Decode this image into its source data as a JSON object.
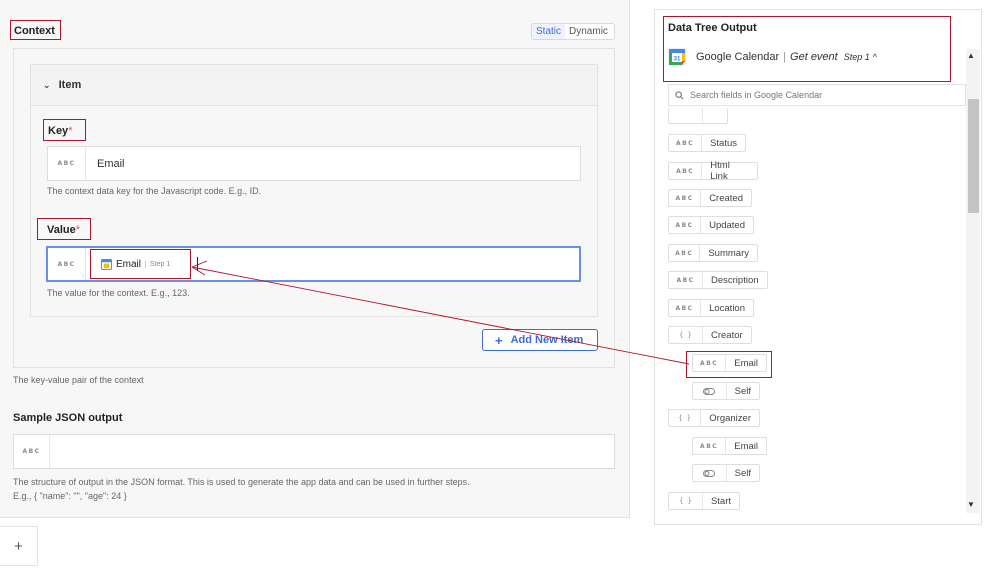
{
  "left": {
    "context_label": "Context",
    "toggle": {
      "static": "Static",
      "dynamic": "Dynamic"
    },
    "item_header": "Item",
    "key": {
      "label": "Key",
      "required_mark": "*",
      "type_prefix": "ABC",
      "value": "Email",
      "help": "The context data key for the Javascript code. E.g., ID."
    },
    "value": {
      "label": "Value",
      "required_mark": "*",
      "type_prefix": "ABC",
      "chip_label": "Email",
      "chip_step": "Step 1",
      "help": "The value for the context. E.g., 123."
    },
    "add_new_item": "Add New Item",
    "pair_help": "The key-value pair of the context",
    "sample": {
      "label": "Sample JSON output",
      "type_prefix": "ABC",
      "help_line1": "The structure of output in the JSON format. This is used to generate the app data and can be used in further steps.",
      "help_line2": "E.g., { \"name\": \"\", \"age\": 24 }"
    },
    "plus_tab": "+"
  },
  "right": {
    "title": "Data Tree Output",
    "source_app": "Google Calendar",
    "source_sep": "|",
    "source_event": "Get event",
    "source_step": "Step 1",
    "search_placeholder": "Search fields in Google Calendar",
    "abc": "ABC",
    "obj": "{ }",
    "fields": {
      "status": "Status",
      "html_link": "Html Link",
      "created": "Created",
      "updated": "Updated",
      "summary": "Summary",
      "description": "Description",
      "location": "Location",
      "creator": "Creator",
      "creator_email": "Email",
      "creator_self": "Self",
      "organizer": "Organizer",
      "organizer_email": "Email",
      "organizer_self": "Self",
      "start": "Start"
    }
  },
  "colors": {
    "accent_blue": "#3c6ad6",
    "highlight_red": "#b0142a"
  }
}
